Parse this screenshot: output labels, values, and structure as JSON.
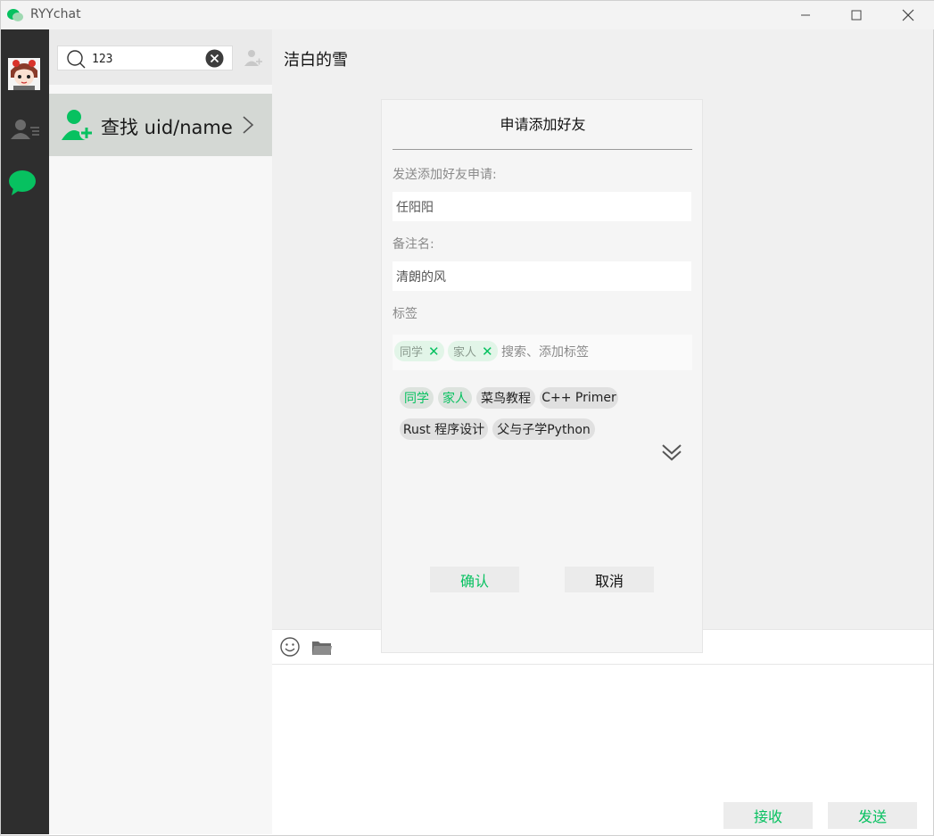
{
  "window": {
    "title": "RYYchat",
    "minimize_glyph": "minimize-icon",
    "maximize_glyph": "maximize-icon",
    "close_glyph": "close-icon"
  },
  "colors": {
    "accent": "#07c160",
    "nav_bg": "#2e2e2e",
    "find_row_bg": "#d4d8d4"
  },
  "search": {
    "value": "123",
    "find_label": "查找 uid/name"
  },
  "chat": {
    "title": "洁白的雪",
    "receive_label": "接收",
    "send_label": "发送"
  },
  "dialog": {
    "title": "申请添加好友",
    "request_label": "发送添加好友申请:",
    "request_value": "任阳阳",
    "remark_label": "备注名:",
    "remark_value": "清朗的风",
    "tags_label": "标签",
    "selected_tags": [
      "同学",
      "家人"
    ],
    "tag_search_placeholder": "搜索、添加标签",
    "available_tags": [
      "同学",
      "家人",
      "菜鸟教程",
      "C++ Primer",
      "Rust 程序设计",
      "父与子学Python"
    ],
    "confirm_label": "确认",
    "cancel_label": "取消"
  }
}
